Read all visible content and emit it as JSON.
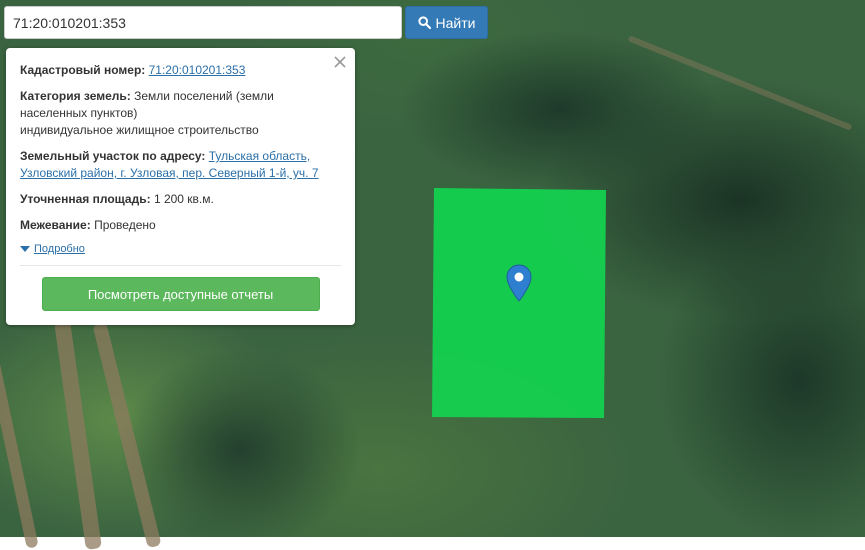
{
  "search": {
    "value": "71:20:010201:353",
    "button_label": "Найти"
  },
  "popup": {
    "cadastral": {
      "label": "Кадастровый номер:",
      "value": "71:20:010201:353"
    },
    "category": {
      "label": "Категория земель:",
      "value": "Земли поселений (земли населенных пунктов)",
      "usage": "индивидуальное жилищное строительство"
    },
    "address": {
      "label": "Земельный участок по адресу:",
      "value": "Тульская область, Узловский район, г. Узловая, пер. Северный 1-й, уч. 7"
    },
    "area": {
      "label": "Уточненная площадь:",
      "value": "1 200 кв.м."
    },
    "survey": {
      "label": "Межевание:",
      "value": "Проведено"
    },
    "details_label": "Подробно",
    "reports_button": "Посмотреть доступные отчеты"
  },
  "colors": {
    "parcel": "#12d44f",
    "search_button": "#337ab7",
    "reports_button": "#5cb85c",
    "marker": "#2f7fd0",
    "link": "#2a6fa8"
  },
  "icons": {
    "search": "search-icon",
    "close": "close-icon",
    "marker": "map-marker-icon",
    "expand": "caret-down-icon"
  }
}
